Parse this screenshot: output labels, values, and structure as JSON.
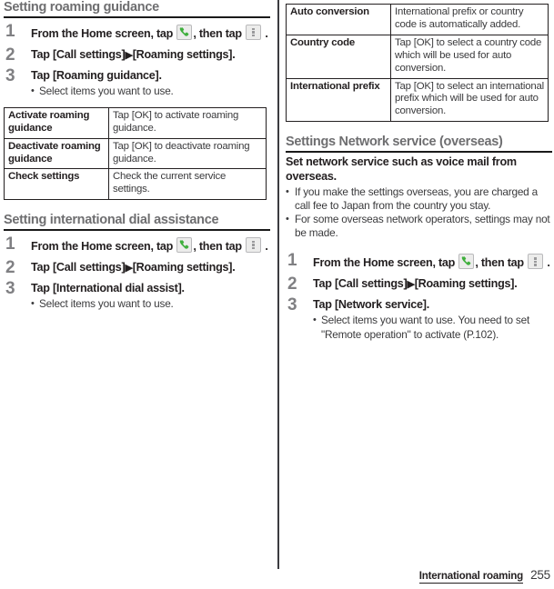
{
  "icons": {
    "phone": "phone-handset-icon",
    "menu": "overflow-menu-icon",
    "arrow": "▶"
  },
  "left_column": {
    "section1": {
      "heading": "Setting roaming guidance",
      "steps": [
        {
          "num": "1",
          "parts": [
            "From the Home screen, tap ",
            ", then tap ",
            " ."
          ],
          "notes": []
        },
        {
          "num": "2",
          "parts": [
            "Tap [Call settings]",
            "[Roaming settings]."
          ],
          "notes": []
        },
        {
          "num": "3",
          "parts": [
            "Tap [Roaming guidance]."
          ],
          "notes": [
            "Select items you want to use."
          ]
        }
      ],
      "table": {
        "rows": [
          {
            "key": "Activate roaming guidance",
            "value": "Tap [OK] to activate roaming guidance."
          },
          {
            "key": "Deactivate roaming guidance",
            "value": "Tap [OK] to deactivate roaming guidance."
          },
          {
            "key": "Check settings",
            "value": "Check the current service settings."
          }
        ]
      }
    },
    "section2": {
      "heading": "Setting international dial assistance",
      "steps": [
        {
          "num": "1",
          "parts": [
            "From the Home screen, tap ",
            ", then tap ",
            " ."
          ],
          "notes": []
        },
        {
          "num": "2",
          "parts": [
            "Tap [Call settings]",
            "[Roaming settings]."
          ],
          "notes": []
        },
        {
          "num": "3",
          "parts": [
            "Tap [International dial assist]."
          ],
          "notes": [
            "Select items you want to use."
          ]
        }
      ]
    }
  },
  "right_column": {
    "table_top": {
      "rows": [
        {
          "key": "Auto conversion",
          "value": "International prefix or country code is automatically added."
        },
        {
          "key": "Country code",
          "value": "Tap [OK] to select a country code which will be used for auto conversion."
        },
        {
          "key": "International prefix",
          "value": "Tap [OK] to select an international prefix which will be used for auto conversion."
        }
      ]
    },
    "section3": {
      "heading": "Settings Network service (overseas)",
      "lead": "Set network service such as voice mail from overseas.",
      "lead_notes": [
        "If you make the settings overseas, you are charged a call fee to Japan from the country you stay.",
        "For some overseas network operators, settings may not be made."
      ],
      "steps": [
        {
          "num": "1",
          "parts": [
            "From the Home screen, tap ",
            ", then tap ",
            " ."
          ],
          "notes": []
        },
        {
          "num": "2",
          "parts": [
            "Tap [Call settings]",
            "[Roaming settings]."
          ],
          "notes": []
        },
        {
          "num": "3",
          "parts": [
            "Tap [Network service]."
          ],
          "notes": [
            "Select items you want to use. You need to set \"Remote operation\" to activate (P.102)."
          ]
        }
      ]
    }
  },
  "footer": {
    "title": "International roaming",
    "page": "255"
  }
}
